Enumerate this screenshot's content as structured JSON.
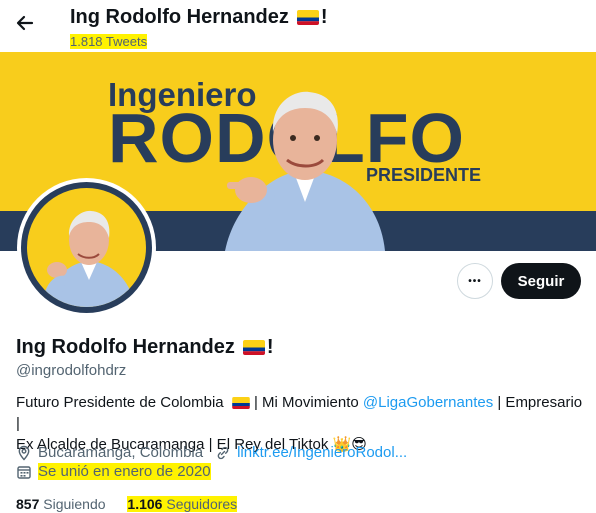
{
  "header": {
    "back_icon": "arrow-left-icon",
    "title": "Ing Rodolfo Hernandez",
    "title_suffix": "!",
    "tweet_count": "1.818 Tweets"
  },
  "banner": {
    "line1": "Ingeniero",
    "line2": "RODOLFO",
    "line3": "PRESIDENTE"
  },
  "actions": {
    "more_label": "•••",
    "follow_label": "Seguir"
  },
  "profile": {
    "name": "Ing Rodolfo Hernandez",
    "name_suffix": "!",
    "handle": "@ingrodolfohdrz",
    "bio": {
      "part1": "Futuro Presidente de Colombia",
      "part2": " | Mi Movimiento ",
      "mention": "@LigaGobernantes",
      "part3": " | Empresario |",
      "line2": "Ex Alcalde de Bucaramanga | El Rey del Tiktok",
      "emoji": "👑😎"
    },
    "location": "Bucaramanga, Colombia",
    "website": "linktr.ee/IngenieroRodol...",
    "joined": "Se unió en enero de 2020",
    "following_count": "857",
    "following_label": "Siguiendo",
    "followers_count": "1.106",
    "followers_label": "Seguidores"
  },
  "colors": {
    "brand_yellow": "#f8cd1c",
    "brand_navy": "#283d5b",
    "link_blue": "#1d9bf0",
    "highlight": "#fff200"
  }
}
